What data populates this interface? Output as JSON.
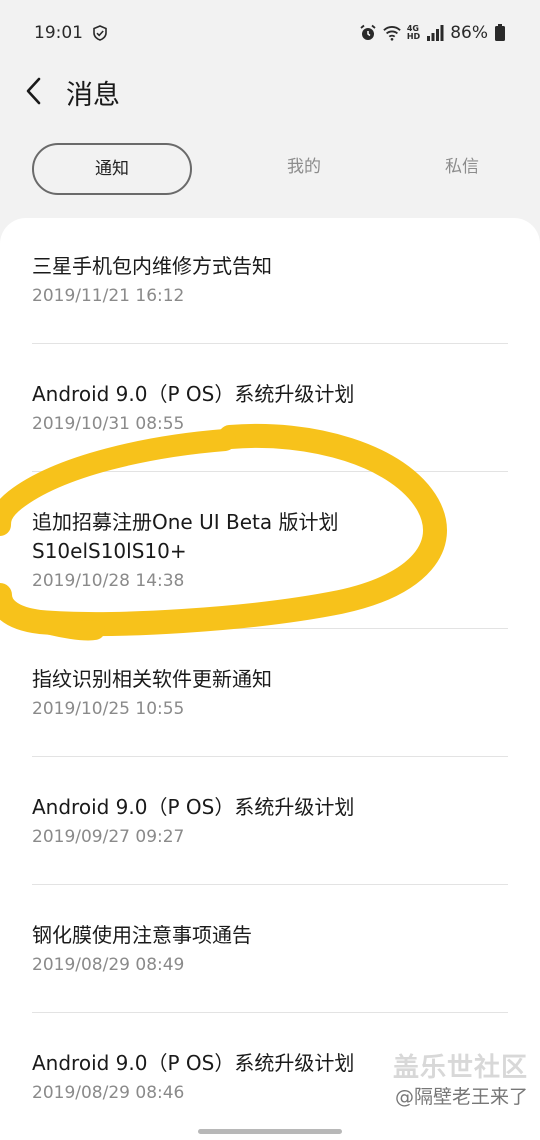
{
  "status": {
    "time": "19:01",
    "battery": "86%",
    "network_tag_top": "4G",
    "network_tag_hd": "HD"
  },
  "header": {
    "title": "消息"
  },
  "tabs": [
    {
      "label": "通知",
      "active": true
    },
    {
      "label": "我的",
      "active": false
    },
    {
      "label": "私信",
      "active": false
    }
  ],
  "notifications": [
    {
      "title": "三星手机包内维修方式告知",
      "date": "2019/11/21 16:12"
    },
    {
      "title": "Android 9.0（P OS）系统升级计划",
      "date": "2019/10/31 08:55"
    },
    {
      "title": "追加招募注册One UI Beta 版计划",
      "title_line2": "S10elS10lS10+",
      "date": "2019/10/28 14:38"
    },
    {
      "title": "指纹识别相关软件更新通知",
      "date": "2019/10/25 10:55"
    },
    {
      "title": "Android 9.0（P OS）系统升级计划",
      "date": "2019/09/27 09:27"
    },
    {
      "title": "钢化膜使用注意事项通告",
      "date": "2019/08/29 08:49"
    },
    {
      "title": "Android 9.0（P OS）系统升级计划",
      "date": "2019/08/29 08:46"
    }
  ],
  "watermark": {
    "main": "盖乐世社区",
    "sub": "@隔壁老王来了"
  },
  "colors": {
    "highlight": "#f7c21b",
    "background": "#f2f2f2",
    "card": "#ffffff"
  }
}
